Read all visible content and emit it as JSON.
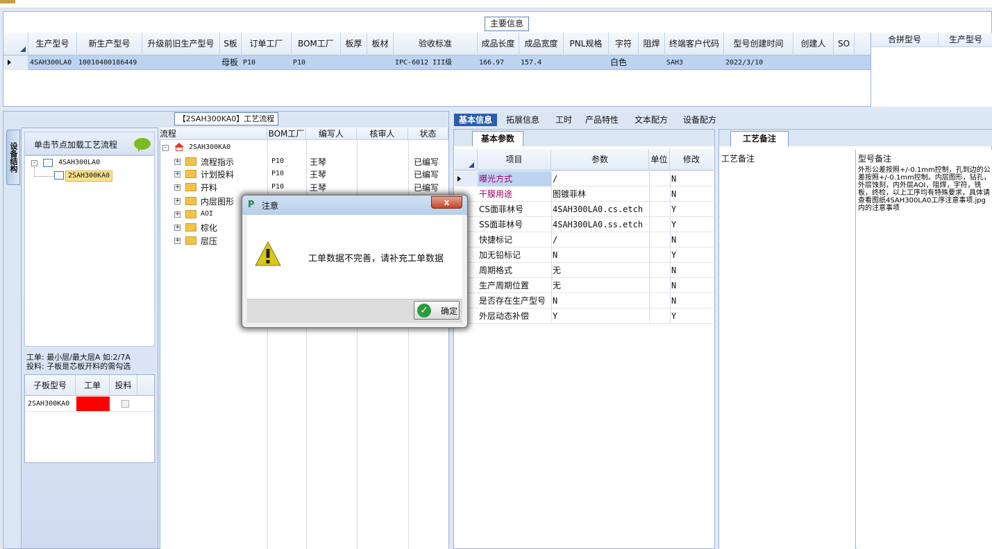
{
  "main": {
    "title": "主要信息",
    "columns": [
      "生产型号",
      "新生产型号",
      "升级前旧生产型号",
      "S板",
      "订单工厂",
      "BOM工厂",
      "板厚",
      "板材",
      "验收标准",
      "成品长度",
      "成品宽度",
      "PNL规格",
      "字符",
      "阻焊",
      "终端客户代码",
      "型号创建时间",
      "创建人",
      "SO"
    ],
    "row": [
      "4SAH300LA0",
      "10010400186449",
      "",
      "母板",
      "P10",
      "P10",
      "",
      "",
      "IPC-6012 III级",
      "166.97",
      "157.4",
      "",
      "白色",
      "",
      "SAH3",
      "2022/3/10",
      "",
      ""
    ],
    "merge_columns": [
      "合拼型号",
      "生产型号"
    ]
  },
  "left": {
    "side_tab": "设备结构",
    "flow_title": "【2SAH300KA0】工艺流程",
    "tree_header": "单击节点加载工艺流程",
    "tree_nodes": [
      "4SAH300LA0",
      "2SAH300KA0"
    ],
    "note_line1": "工单: 最小层/最大层A 如:2/7A",
    "note_line2": "投料: 子板是芯板开料的需勾选",
    "sub_columns": [
      "子板型号",
      "工单",
      "投料"
    ],
    "sub_row": "2SAH300KA0",
    "error_color": "#ff0000"
  },
  "flow": {
    "columns": [
      "流程",
      "BOM工厂",
      "编写人",
      "核审人",
      "状态"
    ],
    "root": "2SAH300KA0",
    "rows": [
      {
        "name": "流程指示",
        "bom": "P10",
        "writer": "王琴",
        "status": "已编写"
      },
      {
        "name": "计划投料",
        "bom": "P10",
        "writer": "王琴",
        "status": "已编写"
      },
      {
        "name": "开料",
        "bom": "P10",
        "writer": "王琴",
        "status": "已编写"
      },
      {
        "name": "内层图形",
        "bom": "",
        "writer": "",
        "status": ""
      },
      {
        "name": "AOI",
        "bom": "",
        "writer": "",
        "status": ""
      },
      {
        "name": "棕化",
        "bom": "",
        "writer": "",
        "status": ""
      },
      {
        "name": "层压",
        "bom": "",
        "writer": "",
        "status": ""
      }
    ]
  },
  "tabs": [
    "基本信息",
    "拓展信息",
    "工时",
    "产品特性",
    "文本配方",
    "设备配方"
  ],
  "basic": {
    "tab": "基本参数",
    "columns": [
      "项目",
      "参数",
      "单位",
      "修改"
    ],
    "rows": [
      {
        "item": "曝光方式",
        "param": "/",
        "unit": "",
        "mod": "N",
        "color": "#a0006e"
      },
      {
        "item": "干膜用途",
        "param": "图镀菲林",
        "unit": "",
        "mod": "N",
        "color": "#a0006e"
      },
      {
        "item": "CS面菲林号",
        "param": "4SAH300LA0.cs.etch",
        "unit": "",
        "mod": "Y",
        "color": "#111111"
      },
      {
        "item": "SS面菲林号",
        "param": "4SAH300LA0.ss.etch",
        "unit": "",
        "mod": "Y",
        "color": "#111111"
      },
      {
        "item": "快捷标记",
        "param": "/",
        "unit": "",
        "mod": "N",
        "color": "#111111"
      },
      {
        "item": "加无铅标记",
        "param": "N",
        "unit": "",
        "mod": "Y",
        "color": "#111111"
      },
      {
        "item": "周期格式",
        "param": "无",
        "unit": "",
        "mod": "N",
        "color": "#111111"
      },
      {
        "item": "生产周期位置",
        "param": "无",
        "unit": "",
        "mod": "N",
        "color": "#111111"
      },
      {
        "item": "是否存在生产型号",
        "param": "N",
        "unit": "",
        "mod": "N",
        "color": "#111111"
      },
      {
        "item": "外层动态补偿",
        "param": "Y",
        "unit": "",
        "mod": "Y",
        "color": "#111111"
      }
    ]
  },
  "remark": {
    "tab": "工艺备注",
    "left_header": "工艺备注",
    "right_header": "型号备注",
    "text": "外形公差按照+/-0.1mm控制，孔到边的公差按照+/-0.1mm控制。内层图形，钻孔，外层蚀刻，内外层AOI，阻焊，字符，铣板，终检，以上工序均有特殊要求，具体请查看图纸4SAH300LA0工序注意事项.jpg内的注意事项"
  },
  "dialog": {
    "title": "注意",
    "message": "工单数据不完善，请补充工单数据",
    "ok": "确定",
    "close": "x"
  }
}
